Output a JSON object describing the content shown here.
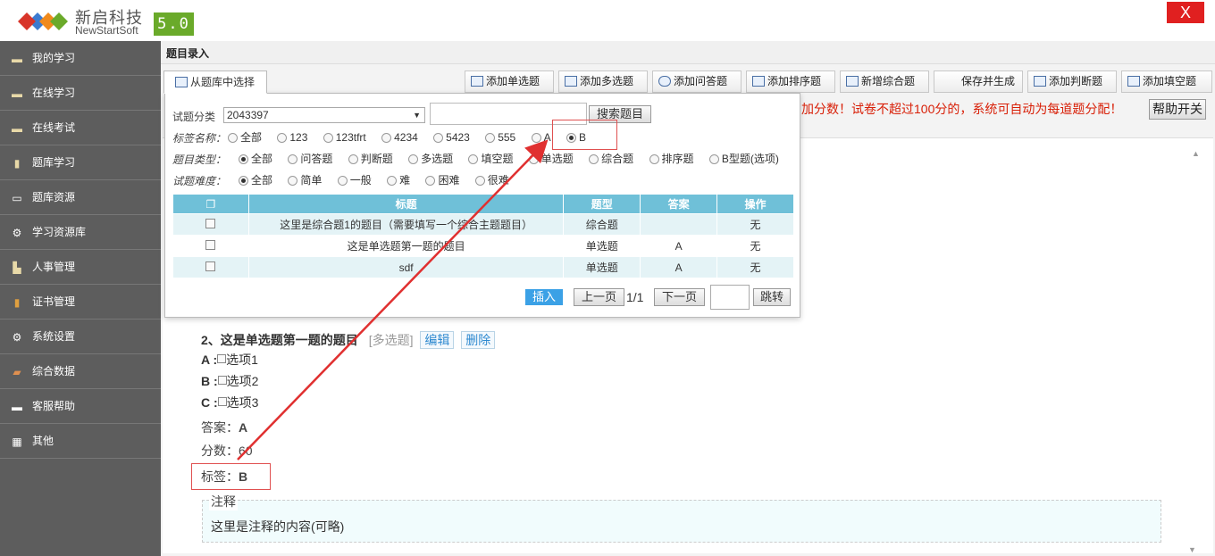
{
  "header": {
    "brand_cn": "新启科技",
    "brand_en": "NewStartSoft",
    "version": "5.0",
    "close_label": "X"
  },
  "sidebar": {
    "items": [
      {
        "label": "我的学习",
        "icon": "folder-icon"
      },
      {
        "label": "在线学习",
        "icon": "folder-icon"
      },
      {
        "label": "在线考试",
        "icon": "folder-icon"
      },
      {
        "label": "题库学习",
        "icon": "book-icon"
      },
      {
        "label": "题库资源",
        "icon": "monitor-icon"
      },
      {
        "label": "学习资源库",
        "icon": "gear-icon"
      },
      {
        "label": "人事管理",
        "icon": "person-icon"
      },
      {
        "label": "证书管理",
        "icon": "certificate-icon"
      },
      {
        "label": "系统设置",
        "icon": "gear-icon"
      },
      {
        "label": "综合数据",
        "icon": "box-icon"
      },
      {
        "label": "客服帮助",
        "icon": "message-icon"
      },
      {
        "label": "其他",
        "icon": "grid-icon"
      }
    ]
  },
  "main": {
    "section_title": "题目录入",
    "toolbar": {
      "from_bank": "从题库中选择",
      "add_single": "添加单选题",
      "add_multi": "添加多选题",
      "add_qa": "添加问答题",
      "add_sort": "添加排序题",
      "add_combo": "新增综合题",
      "save_generate": "保存并生成",
      "add_judge": "添加判断题",
      "add_fill": "添加填空题"
    },
    "notice": "加分数！试卷不超过100分的，系统可自动为每道题分配！",
    "help": "帮助开关"
  },
  "picker": {
    "category_label": "试题分类",
    "category_value": "2043397",
    "search_button": "搜索题目",
    "tag_label": "标签名称：",
    "tags": [
      "全部",
      "123",
      "123tfrt",
      "4234",
      "5423",
      "555",
      "A",
      "B"
    ],
    "tag_selected": "B",
    "type_label": "题目类型：",
    "types": [
      "全部",
      "问答题",
      "判断题",
      "多选题",
      "填空题",
      "单选题",
      "综合题",
      "排序题",
      "B型题(选项)"
    ],
    "type_selected": "全部",
    "difficulty_label": "试题难度：",
    "difficulties": [
      "全部",
      "简单",
      "一般",
      "难",
      "困难",
      "很难"
    ],
    "difficulty_selected": "全部",
    "table": {
      "headers": [
        "标题",
        "题型",
        "答案",
        "操作"
      ],
      "rows": [
        {
          "title": "这里是综合题1的题目（需要填写一个综合主题题目）",
          "type": "综合题",
          "answer": "",
          "op": "无"
        },
        {
          "title": "这是单选题第一题的题目",
          "type": "单选题",
          "answer": "A",
          "op": "无"
        },
        {
          "title": "sdf",
          "type": "单选题",
          "answer": "A",
          "op": "无"
        }
      ]
    },
    "insert": "插入",
    "prev": "上一页",
    "page": "1/1",
    "next": "下一页",
    "jump": "跳转"
  },
  "question": {
    "title": "2、这是单选题第一题的题目",
    "type_tag": "[多选题]",
    "edit": "编辑",
    "delete": "删除",
    "options": [
      {
        "key": "A :",
        "text": "选项1"
      },
      {
        "key": "B :",
        "text": "选项2"
      },
      {
        "key": "C :",
        "text": "选项3"
      }
    ],
    "answer_label": "答案：",
    "answer_value": "A",
    "score_label": "分数：",
    "score_value": "60",
    "tag_label": "标签：",
    "tag_value": "B",
    "note_label": "注释",
    "note_text": "这里是注释的内容(可略)"
  },
  "colors": {
    "sidebar_bg": "#5d5d5d",
    "accent_blue": "#3ba1e6",
    "table_header": "#6fc0d8",
    "notice_red": "#d81e06",
    "annotation_red": "#e03030",
    "version_green": "#6aaa2a"
  }
}
